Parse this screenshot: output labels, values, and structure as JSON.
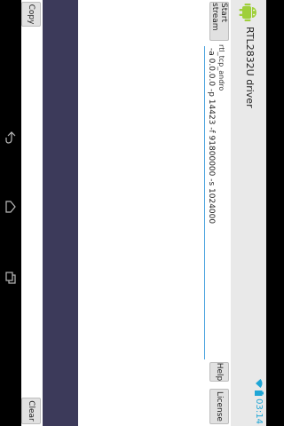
{
  "app": {
    "title": "RTL2832U driver"
  },
  "status": {
    "time": "03:14"
  },
  "form": {
    "start_button": "Start stream",
    "field_label": "rtl_tcp_andro",
    "args_value": "-a 0.0.0.0 -p 14423 -f 91800000 -s 1024000"
  },
  "buttons": {
    "help": "Help",
    "license": "License",
    "copy": "Copy",
    "clear": "Clear"
  },
  "icons": {
    "app": "android-icon",
    "wifi": "wifi-icon",
    "battery": "battery-icon",
    "back": "back-icon",
    "home": "home-icon",
    "recents": "recents-icon"
  },
  "colors": {
    "log_background": "#3c3a5a",
    "accent": "#1fa6d6"
  }
}
